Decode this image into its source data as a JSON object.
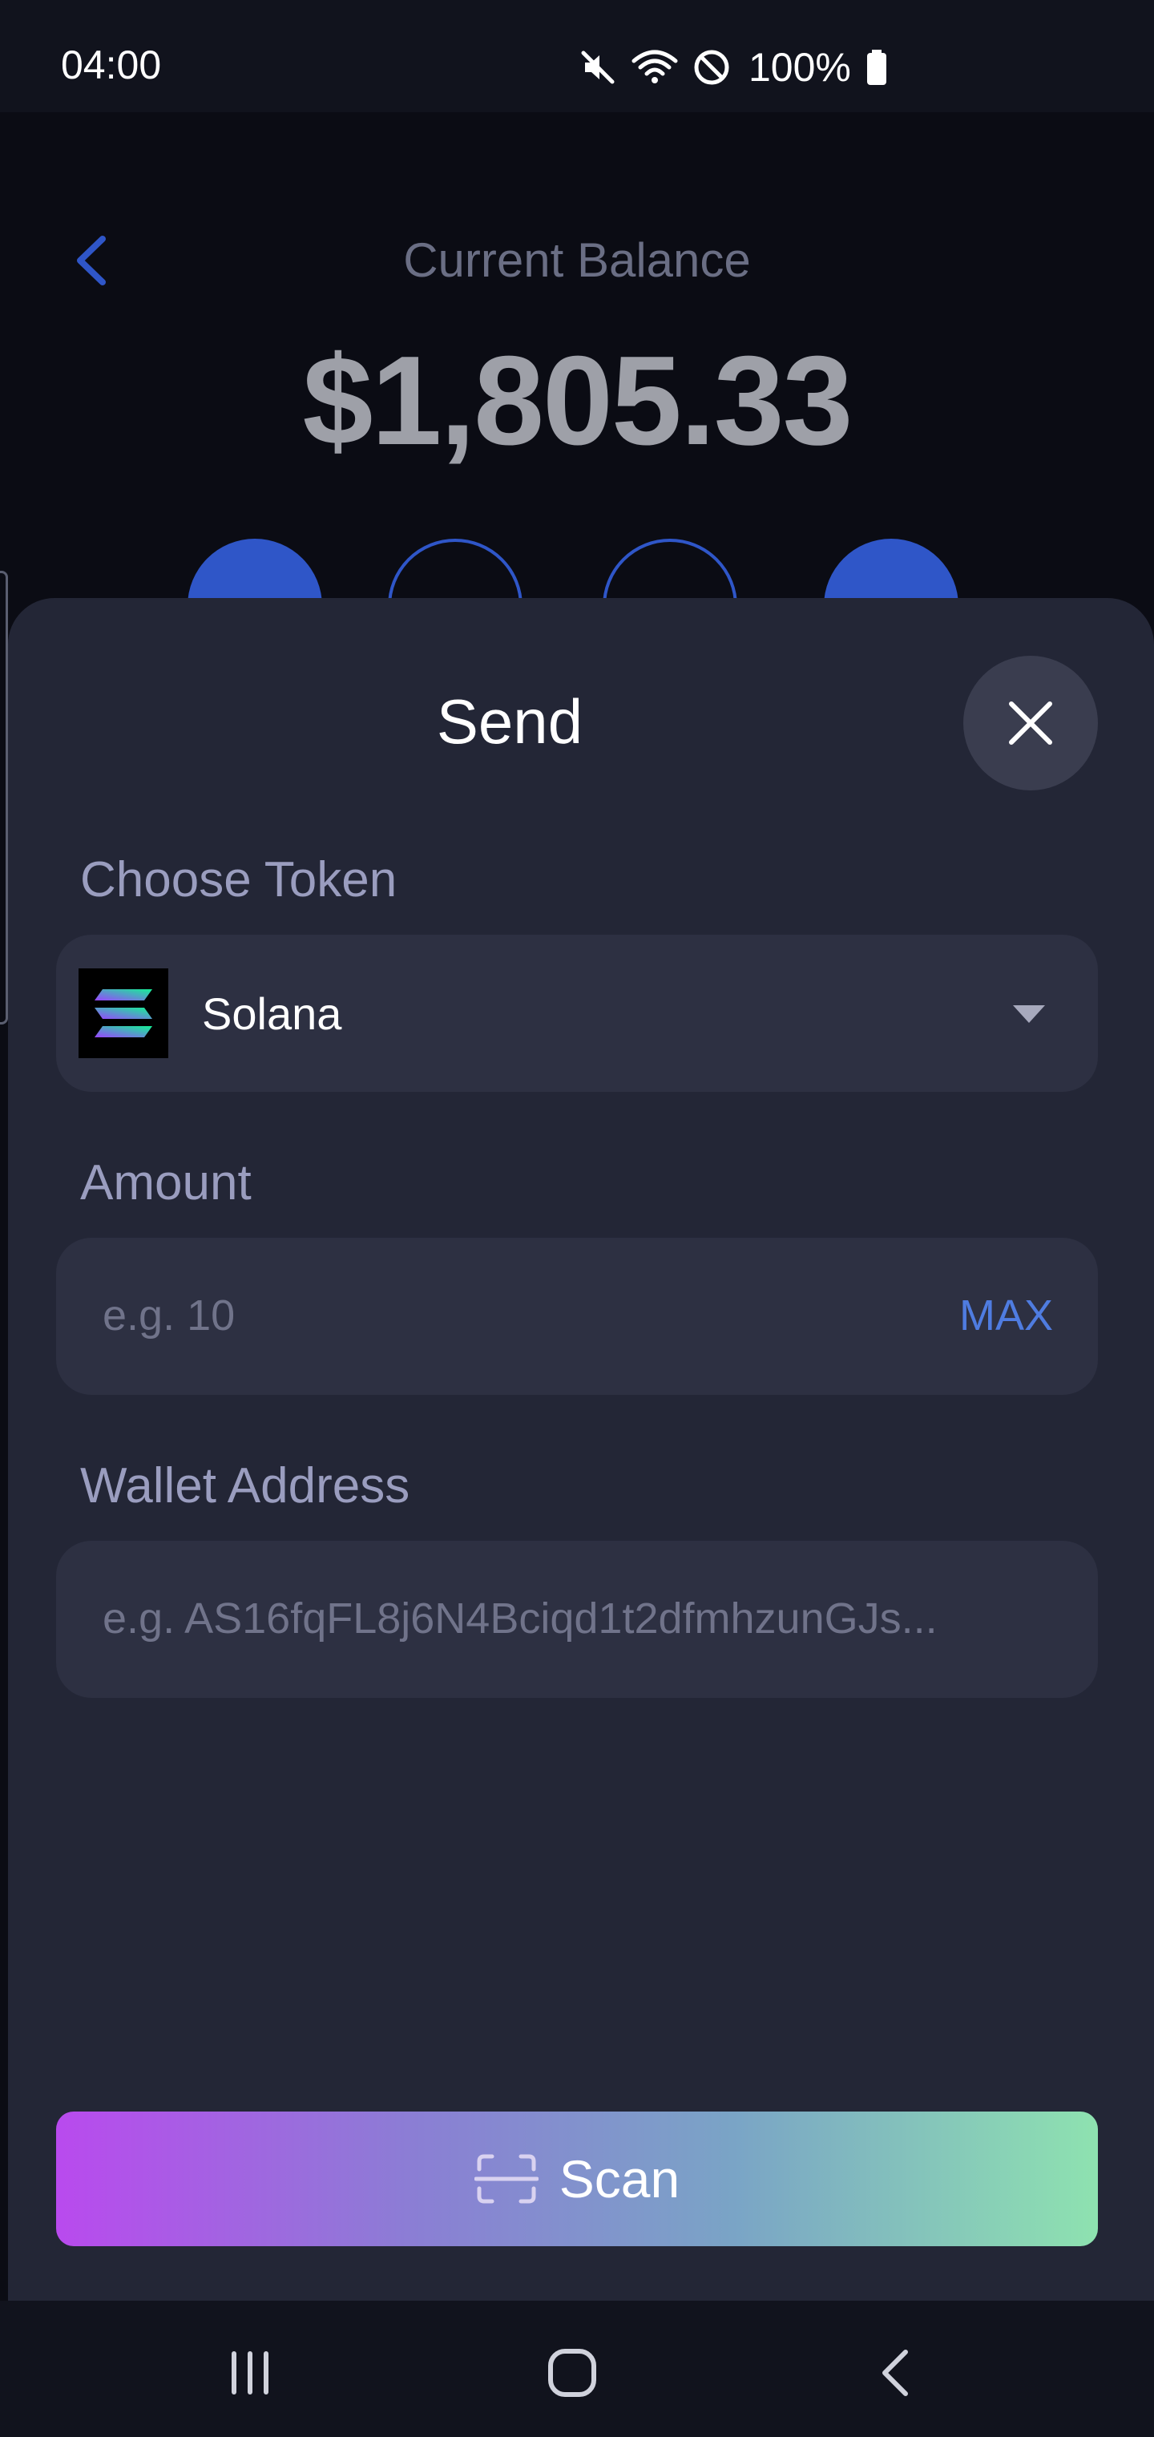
{
  "status_bar": {
    "time": "04:00",
    "battery_text": "100%",
    "icons": [
      "mute-icon",
      "wifi-icon",
      "do-not-disturb-icon",
      "battery-icon"
    ]
  },
  "header": {
    "balance_label": "Current Balance",
    "balance_amount": "$1,805.33",
    "accent_color": "#2f56c8"
  },
  "send_sheet": {
    "title": "Send",
    "choose_token_label": "Choose Token",
    "token": {
      "name": "Solana",
      "icon": "solana-logo"
    },
    "amount_label": "Amount",
    "amount_placeholder": "e.g. 10",
    "max_label": "MAX",
    "wallet_label": "Wallet Address",
    "wallet_placeholder": "e.g. AS16fqFL8j6N4Bciqd1t2dfmhzunGJs...",
    "scan_label": "Scan"
  },
  "nav_bar": {
    "buttons": [
      "recents-icon",
      "home-icon",
      "back-icon"
    ]
  }
}
